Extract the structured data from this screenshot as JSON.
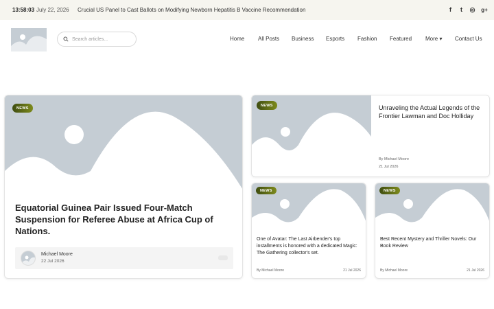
{
  "topbar": {
    "time": "13:58:03",
    "date": "July 22, 2026",
    "ticker": "Crucial US Panel to Cast Ballots on Modifying Newborn Hepatitis B Vaccine Recommendation",
    "social": [
      {
        "name": "facebook-icon",
        "glyph": "f"
      },
      {
        "name": "twitter-icon",
        "glyph": "t"
      },
      {
        "name": "instagram-icon",
        "glyph": "◎"
      },
      {
        "name": "google-plus-icon",
        "glyph": "g+"
      }
    ]
  },
  "search": {
    "placeholder": "Search articles..."
  },
  "nav": [
    "Home",
    "All Posts",
    "Business",
    "Esports",
    "Fashion",
    "Featured",
    "More ▾",
    "Contact Us"
  ],
  "featured": {
    "badge": "NEWS",
    "title": "Equatorial Guinea Pair Issued Four-Match Suspension for Referee Abuse at Africa Cup of Nations.",
    "author": "Michael Moore",
    "date": "22 Jul 2026"
  },
  "side_top": {
    "badge": "NEWS",
    "title": "Unraveling the Actual Legends of the Frontier Lawman and Doc Holliday",
    "author": "By Michael Moore",
    "date": "21 Jul 2026"
  },
  "small_cards": [
    {
      "badge": "NEWS",
      "title": "One of Avatar: The Last Airbender's top installments is honored with a dedicated Magic: The Gathering collector's set.",
      "author": "By Michael Moore",
      "date": "21 Jul 2026"
    },
    {
      "badge": "NEWS",
      "title": "Best Recent Mystery and Thriller Novels: Our Book Review",
      "author": "By Michael Moore",
      "date": "21 Jul 2026"
    }
  ]
}
